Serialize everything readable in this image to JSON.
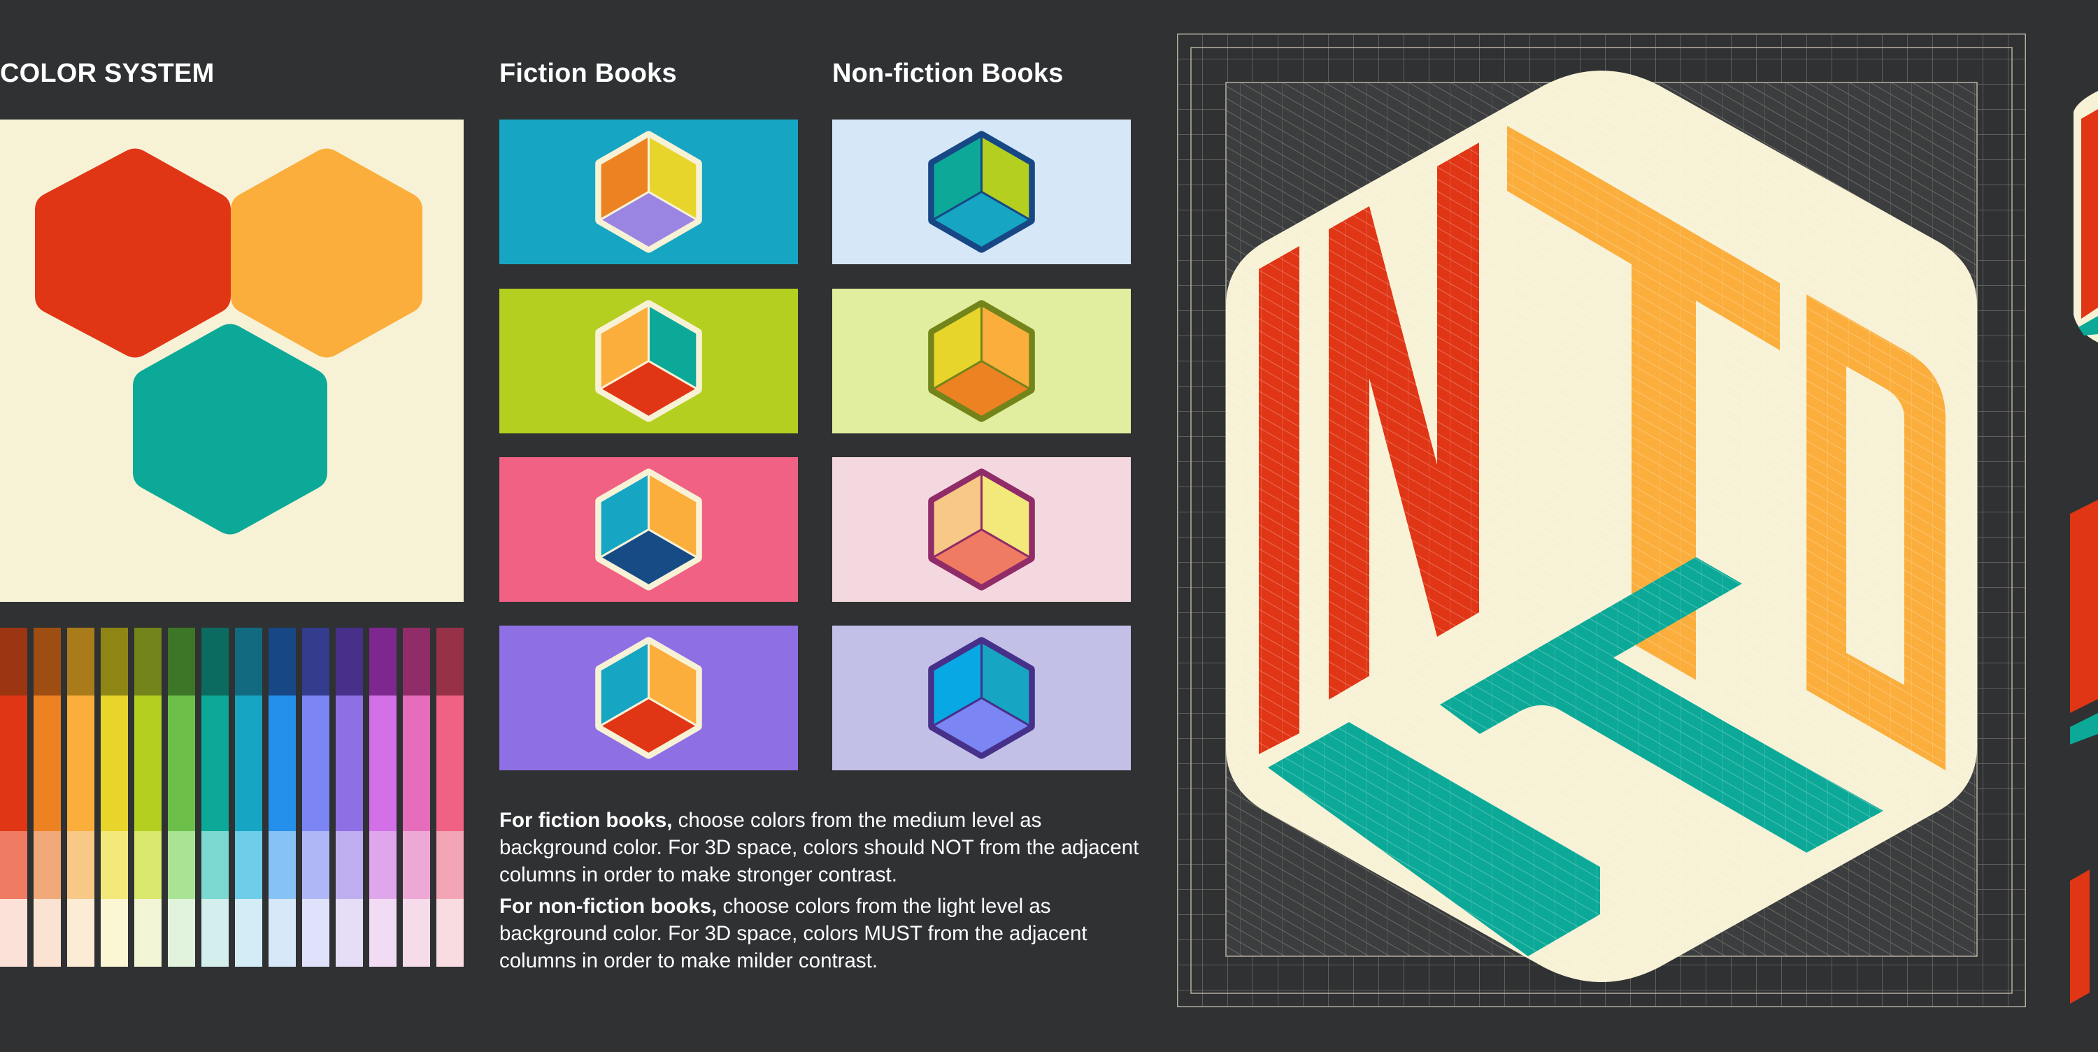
{
  "headings": {
    "color_system": "COLOR SYSTEM",
    "fiction": "Fiction Books",
    "nonfiction": "Non-fiction Books"
  },
  "primary_colors": [
    "#e03616",
    "#fbae3c",
    "#0ca998"
  ],
  "palette": [
    [
      "#9c3512",
      "#e03616",
      "#ef7b62",
      "#fbe1d7"
    ],
    [
      "#9e4e12",
      "#ec8221",
      "#f2a97a",
      "#fbe3d3"
    ],
    [
      "#a97b1a",
      "#fbae3c",
      "#f7c886",
      "#fcecd5"
    ],
    [
      "#8e8614",
      "#e8d52b",
      "#f3e87a",
      "#fbf6d4"
    ],
    [
      "#73841a",
      "#b5cf21",
      "#dae86d",
      "#f2f6d6"
    ],
    [
      "#3e7628",
      "#6cc04a",
      "#a8e493",
      "#e1f3dc"
    ],
    [
      "#0c6b60",
      "#0ca998",
      "#7bd9d2",
      "#d3eeec"
    ],
    [
      "#116a80",
      "#17a5c4",
      "#6ecde9",
      "#d4ecf5"
    ],
    [
      "#174785",
      "#2490ec",
      "#86c2f6",
      "#d7e8f9"
    ],
    [
      "#343c8e",
      "#7b86f4",
      "#b0b7f7",
      "#e0e2fb"
    ],
    [
      "#463089",
      "#8f70e4",
      "#beaef0",
      "#e6ddf6"
    ],
    [
      "#7d278f",
      "#d36fe7",
      "#dfa6ec",
      "#f2dcf4"
    ],
    [
      "#902c68",
      "#e56dbb",
      "#eda8d6",
      "#f6dbea"
    ],
    [
      "#963148",
      "#f06184",
      "#f3a4b5",
      "#f8dce2"
    ]
  ],
  "fiction_swatches": [
    {
      "bg": "#17a5c4",
      "border": "#f7f2d6",
      "left": "#ec8221",
      "right": "#e8d52b",
      "bottom": "#9b85e3"
    },
    {
      "bg": "#b5cf21",
      "border": "#f7f2d6",
      "left": "#fbae3c",
      "right": "#0ca998",
      "bottom": "#e03616"
    },
    {
      "bg": "#f06184",
      "border": "#f7f2d6",
      "left": "#17a5c4",
      "right": "#fbae3c",
      "bottom": "#174b86"
    },
    {
      "bg": "#8f70e4",
      "border": "#f7f2d6",
      "left": "#17a5c4",
      "right": "#fbae3c",
      "bottom": "#e03616"
    }
  ],
  "nonfiction_swatches": [
    {
      "bg": "#d6e7f8",
      "border": "#174785",
      "left": "#0ca998",
      "right": "#b5cf21",
      "bottom": "#17a5c4"
    },
    {
      "bg": "#e1ee9f",
      "border": "#73841a",
      "left": "#e8d52b",
      "right": "#fbae3c",
      "bottom": "#ec8221"
    },
    {
      "bg": "#f4d8e0",
      "border": "#902c68",
      "left": "#f7c886",
      "right": "#f3e87a",
      "bottom": "#ef7b62"
    },
    {
      "bg": "#c3c0e8",
      "border": "#463089",
      "left": "#08a8e4",
      "right": "#17a5c4",
      "bottom": "#7b86f4"
    }
  ],
  "description": {
    "fiction_bold": "For fiction books,",
    "fiction_text": " choose colors from the medium level as background color. For 3D space, colors should NOT from the adjacent columns in order to make stronger contrast.",
    "nonfiction_bold": "For non-fiction books,",
    "nonfiction_text": " choose colors from the light level as background color. For 3D space, colors MUST from the adjacent columns in order to make milder contrast."
  },
  "logo": {
    "letters": [
      "I",
      "N",
      "T",
      "O"
    ],
    "colors": {
      "left": "#e03616",
      "right": "#fbae3c",
      "bottom": "#0ca998",
      "base": "#f7f2d6",
      "grid": "#8f8b80"
    }
  }
}
